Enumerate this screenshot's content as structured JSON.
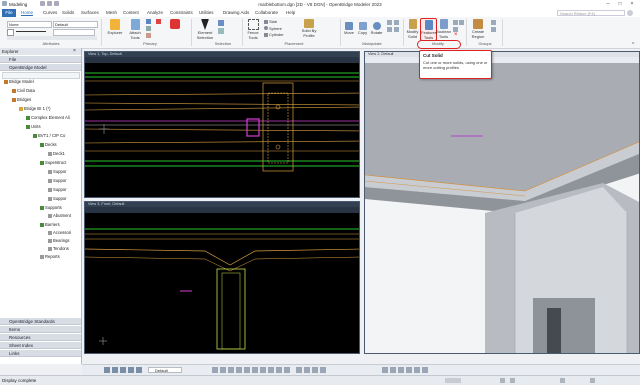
{
  "app": {
    "title": "marblebottom.dgn [2D - V8 DGN] - OpenBridge Modeler 2023",
    "qa_label": "Modeling",
    "search_placeholder": "Search Ribbon (F4)"
  },
  "tabs": [
    "File",
    "Home",
    "Curves",
    "Solids",
    "Surfaces",
    "Mesh",
    "Content",
    "Analyze",
    "Constraints",
    "Utilities",
    "Drawing Aids",
    "Collaborate",
    "Help"
  ],
  "ribbon": {
    "attributes": {
      "level": "None",
      "style": "Default",
      "group_label": "Attributes"
    },
    "primary": {
      "explorer": "Explorer",
      "attach_tools": "Attach Tools",
      "group_label": "Primary"
    },
    "selection": {
      "element_selection": "Element Selection",
      "group_label": "Selection"
    },
    "placement": {
      "fence_tools": "Fence Tools",
      "slab": "Slab",
      "sphere": "Sphere",
      "cylinder": "Cylinder",
      "solid_by_profile": "Solid By Profile",
      "group_label": "Placement"
    },
    "manipulate": {
      "move": "Move",
      "copy": "Copy",
      "rotate": "Rotate",
      "group_label": "Manipulate"
    },
    "modify": {
      "modify_solid": "Modify Solid",
      "features_tools": "Features Tools",
      "boolean_tools": "Boolean Tools",
      "group_label": "Modify"
    },
    "groups": {
      "create_region": "Create Region",
      "group_label": "Groups"
    }
  },
  "tooltip": {
    "title": "Cut Solid",
    "body": "Cut one or more solids, using one or more cutting profiles"
  },
  "explorer": {
    "header": "Explorer",
    "file_section": "File",
    "model_section": "OpenBridge Model",
    "nodes": [
      "Bridge Model",
      "Civil Data",
      "Bridges",
      "Bridge Br 1 (*)",
      "Complex Element Ali",
      "Units",
      "BVT1 / CIP Co",
      "Decks",
      "Deck1",
      "Superstruct",
      "Suppor",
      "Suppor",
      "Suppor",
      "Suppor",
      "Supports",
      "Abutment",
      "Barriers",
      "Accessori",
      "Bearings",
      "Tendons",
      "Reports"
    ],
    "bottom_sections": [
      "OpenBridge Standards",
      "Items",
      "Resources",
      "Sheet Index",
      "Links"
    ]
  },
  "views": {
    "top_left": "View 1, Top, Default",
    "bottom_left": "View 3, Front, Default",
    "right": "View 2, Default"
  },
  "status": {
    "message": "Display complete",
    "view_dropdown": "Default"
  },
  "colors": {
    "accent": "#2f6fb6",
    "highlight": "#d22222",
    "view_bg": "#000000",
    "green": "#27c32a",
    "orange": "#d8a040",
    "magenta": "#d640d6"
  }
}
